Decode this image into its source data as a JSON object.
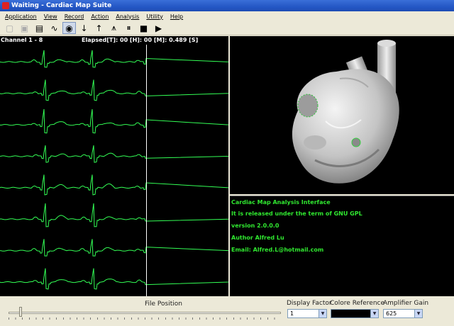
{
  "window": {
    "title": "Waiting - Cardiac Map Suite"
  },
  "menu": [
    "Application",
    "View",
    "Record",
    "Action",
    "Analysis",
    "Utility",
    "Help"
  ],
  "toolbar": [
    {
      "name": "new-icon",
      "glyph": "▢",
      "enabled": false
    },
    {
      "name": "save-icon",
      "glyph": "▣",
      "enabled": false
    },
    {
      "name": "document-icon",
      "glyph": "▤",
      "enabled": true
    },
    {
      "name": "waveform-icon",
      "glyph": "∿",
      "enabled": true
    },
    {
      "name": "eye-icon",
      "glyph": "◉",
      "enabled": true
    },
    {
      "name": "arrow-down-icon",
      "glyph": "↓",
      "enabled": true
    },
    {
      "name": "arrow-up-icon",
      "glyph": "↑",
      "enabled": true
    },
    {
      "name": "tripod-icon",
      "glyph": "⩚",
      "enabled": true
    },
    {
      "name": "pause-icon",
      "glyph": "⏸",
      "enabled": true
    },
    {
      "name": "stop-icon",
      "glyph": "■",
      "enabled": true
    },
    {
      "name": "play-icon",
      "glyph": "▶",
      "enabled": true
    }
  ],
  "ecg": {
    "channel_label": "Channel  1 -  8",
    "elapsed_label": "Elapsed[T]: 00 [H]: 00 [M]: 0.489 [S]",
    "trace_color": "#33ff55",
    "channel_count": 8,
    "cursor_fraction": 0.64
  },
  "info": {
    "text_color": "#30e830",
    "lines": [
      "Cardiac Map Analysis Interface",
      "It is released under the term of GNU GPL",
      "version 2.0.0.0",
      "Author Alfred Lu",
      "Email: Alfred.L@hotmail.com"
    ]
  },
  "controls": {
    "file_position_label": "File Position",
    "file_position_fraction": 0.04,
    "display_factor_label": "Display Factor",
    "display_factor_value": "1",
    "color_reference_label": "Colore Reference",
    "amplifier_gain_label": "Amplifier Gain",
    "amplifier_gain_value": "625"
  }
}
